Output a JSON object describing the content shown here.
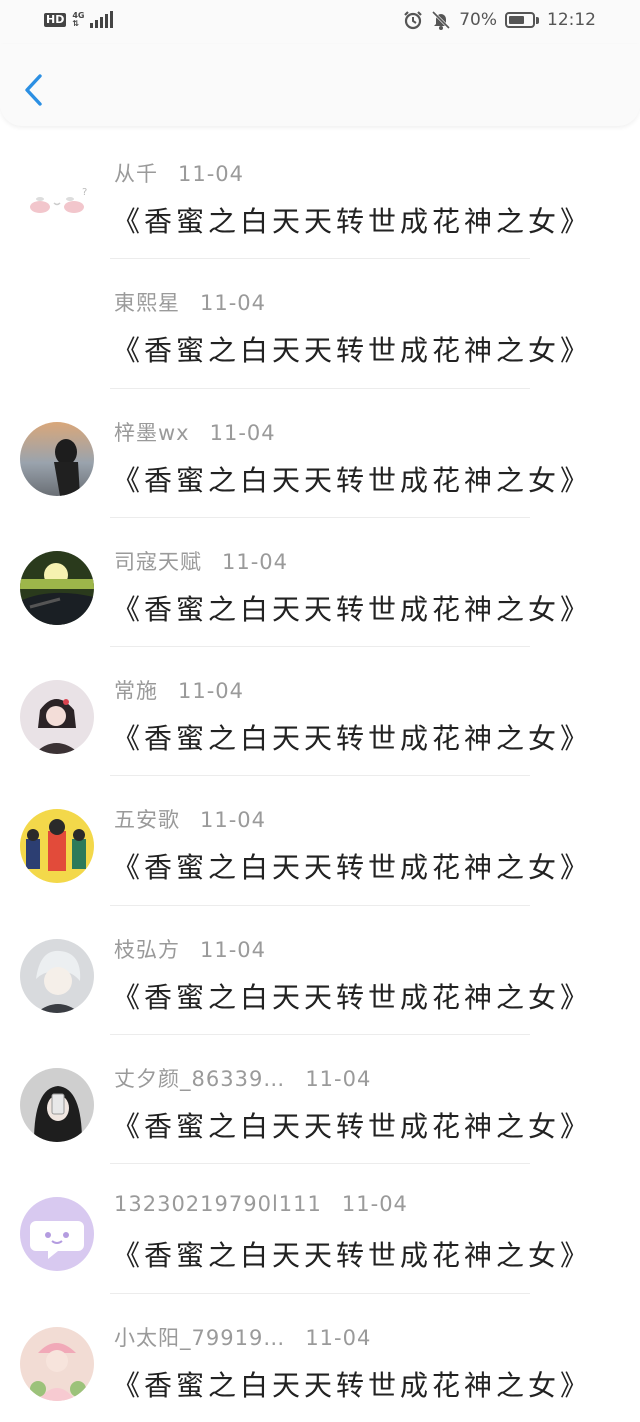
{
  "status_bar": {
    "hd": "HD",
    "network": "4G",
    "battery_percent": "70%",
    "time": "12:12",
    "battery_level": 0.7,
    "icons": [
      "alarm-icon",
      "bell-muted-icon"
    ]
  },
  "header": {
    "back_icon": "chevron-left-icon",
    "accent": "#2b8fe3"
  },
  "messages": [
    {
      "name": "从千",
      "date": "11-04",
      "text": "《香蜜之白天天转世成花神之女》",
      "avatar": "blush-face"
    },
    {
      "name": "東熙星",
      "date": "11-04",
      "text": "《香蜜之白天天转世成花神之女》",
      "avatar": "none"
    },
    {
      "name": "梓墨wx",
      "date": "11-04",
      "text": "《香蜜之白天天转世成花神之女》",
      "avatar": "sunset-girl"
    },
    {
      "name": "司寇天赋",
      "date": "11-04",
      "text": "《香蜜之白天天转世成花神之女》",
      "avatar": "car-sun"
    },
    {
      "name": "常施",
      "date": "11-04",
      "text": "《香蜜之白天天转世成花神之女》",
      "avatar": "girl-bow"
    },
    {
      "name": "五安歌",
      "date": "11-04",
      "text": "《香蜜之白天天转世成花神之女》",
      "avatar": "cartoon-crowd"
    },
    {
      "name": "枝弘方",
      "date": "11-04",
      "text": "《香蜜之白天天转世成花神之女》",
      "avatar": "anime-boy"
    },
    {
      "name": "丈夕颜_86339…",
      "date": "11-04",
      "text": "《香蜜之白天天转世成花神之女》",
      "avatar": "phone-selfie"
    },
    {
      "name": "13230219790l111",
      "date": "11-04",
      "text": "《香蜜之白天天转世成花神之女》",
      "avatar": "chat-bubble"
    },
    {
      "name": "小太阳_79919…",
      "date": "11-04",
      "text": "《香蜜之白天天转世成花神之女》",
      "avatar": "pink-hat-girl"
    }
  ]
}
